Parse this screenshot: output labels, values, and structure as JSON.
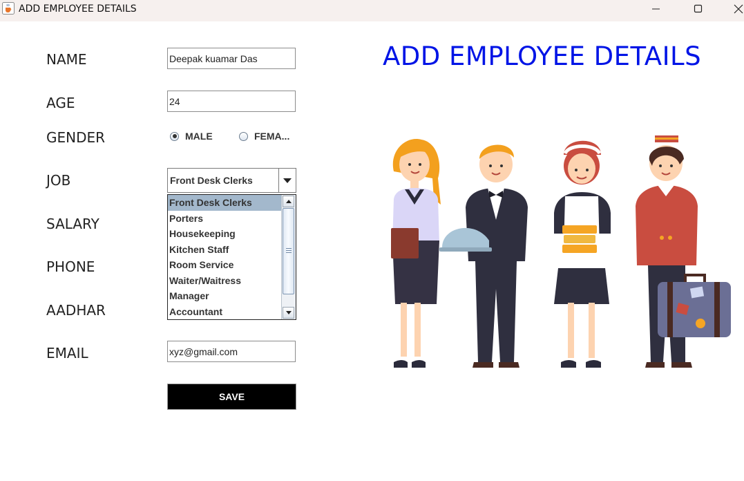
{
  "window": {
    "title": "ADD EMPLOYEE DETAILS",
    "icon": "java-cup-icon",
    "controls": [
      "minimize-icon",
      "maximize-icon",
      "close-icon"
    ]
  },
  "form": {
    "labels": {
      "name": "NAME",
      "age": "AGE",
      "gender": "GENDER",
      "job": "JOB",
      "salary": "SALARY",
      "phone": "PHONE",
      "aadhar": "AADHAR",
      "email": "EMAIL"
    },
    "name_value": "Deepak kuamar Das",
    "age_value": "24",
    "gender": {
      "male_label": "MALE",
      "female_label": "FEMA...",
      "selected": "MALE"
    },
    "job": {
      "selected": "Front Desk Clerks",
      "options": [
        "Front Desk Clerks",
        "Porters",
        "Housekeeping",
        "Kitchen Staff",
        "Room Service",
        "Waiter/Waitress",
        "Manager",
        "Accountant"
      ]
    },
    "email_value": "xyz@gmail.com",
    "save_label": "SAVE"
  },
  "heading": "ADD EMPLOYEE DETAILS",
  "illustration": {
    "subject": "hotel staff characters",
    "figures": [
      "receptionist",
      "waiter",
      "housekeeper",
      "bellboy"
    ]
  },
  "colors": {
    "heading": "#0014e6",
    "save_button_bg": "#000000",
    "save_button_text": "#ffffff",
    "selected_option_bg": "#a3b8cc",
    "titlebar_bg": "#f6f0ee"
  }
}
